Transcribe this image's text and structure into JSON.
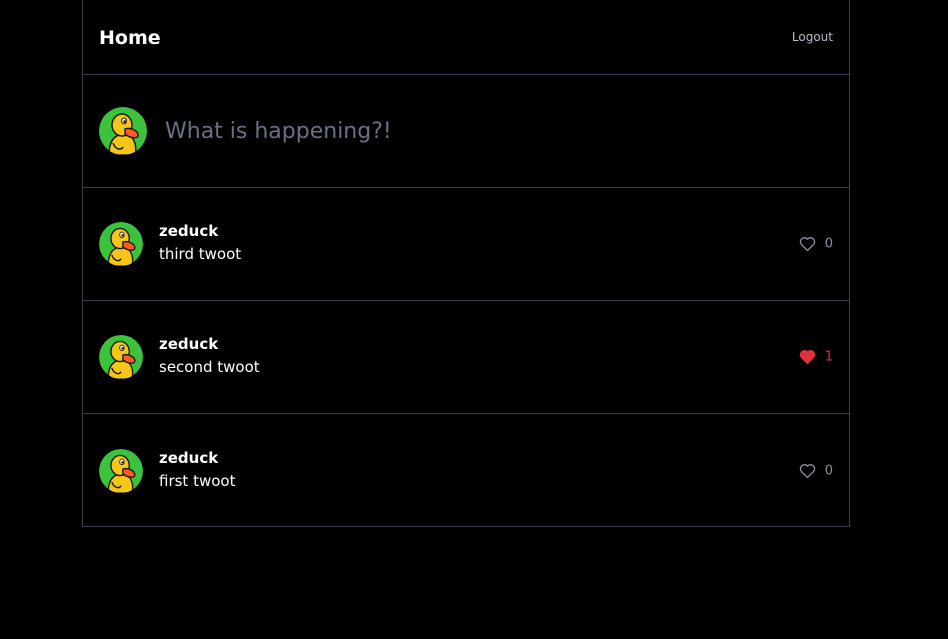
{
  "header": {
    "title": "Home",
    "logout_label": "Logout"
  },
  "compose": {
    "placeholder": "What is happening?!",
    "avatar_icon": "duck-avatar-icon"
  },
  "posts": [
    {
      "username": "zeduck",
      "text": "third twoot",
      "likes": "0",
      "liked": false
    },
    {
      "username": "zeduck",
      "text": "second twoot",
      "likes": "1",
      "liked": true
    },
    {
      "username": "zeduck",
      "text": "first twoot",
      "likes": "0",
      "liked": false
    }
  ],
  "colors": {
    "background": "#000000",
    "border": "#3a3d4d",
    "avatar_green": "#3cc23c",
    "like_active": "#e0313a",
    "muted": "#8a8fa3"
  }
}
